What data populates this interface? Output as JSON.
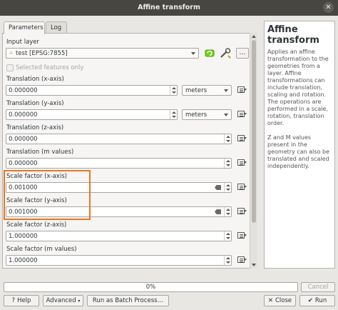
{
  "window": {
    "title": "Affine transform",
    "close_glyph": "✕"
  },
  "tabs": [
    {
      "label": "Parameters"
    },
    {
      "label": "Log"
    }
  ],
  "params": {
    "input_layer": {
      "label": "Input layer",
      "value": "test [EPSG:7855]"
    },
    "selected_only": {
      "label": "Selected features only",
      "checked": false
    },
    "tx": {
      "label": "Translation (x-axis)",
      "value": "0.000000",
      "unit": "meters"
    },
    "ty": {
      "label": "Translation (y-axis)",
      "value": "0.000000",
      "unit": "meters"
    },
    "tz": {
      "label": "Translation (z-axis)",
      "value": "0.000000"
    },
    "tm": {
      "label": "Translation (m values)",
      "value": "0.000000"
    },
    "sx": {
      "label": "Scale factor (x-axis)",
      "value": "0.001000"
    },
    "sy": {
      "label": "Scale factor (y-axis)",
      "value": "0.001000"
    },
    "sz": {
      "label": "Scale factor (z-axis)",
      "value": "1.000000"
    },
    "sm": {
      "label": "Scale factor (m values)",
      "value": "1.000000"
    }
  },
  "help": {
    "title": "Affine transform",
    "p1": "Applies an affine transformation to the geometries from a layer. Affine transformations can include translation, scaling and rotation. The operations are performed in a scale, rotation, translation order.",
    "p2": "Z and M values present in the geometry can also be translated and scaled independently."
  },
  "progress": {
    "text": "0%",
    "value": 0
  },
  "buttons": {
    "cancel": "Cancel",
    "help": "Help",
    "advanced": "Advanced",
    "batch": "Run as Batch Process…",
    "close": "Close",
    "run": "Run"
  },
  "colors": {
    "highlight": "#e87722",
    "titlebar": "#474641"
  }
}
